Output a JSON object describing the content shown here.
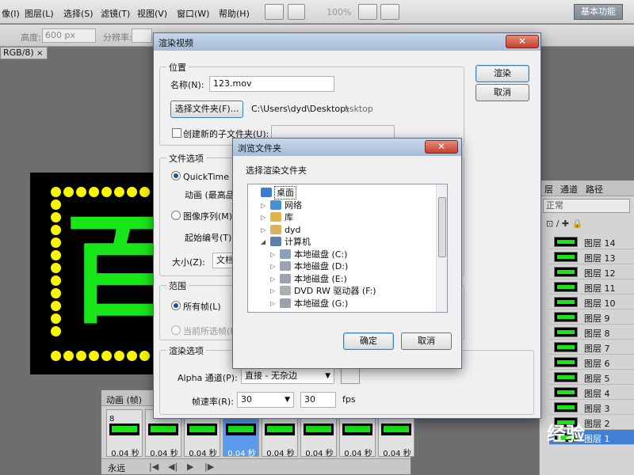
{
  "menu": {
    "items": [
      "像(I)",
      "图层(L)",
      "选择(S)",
      "滤镜(T)",
      "视图(V)",
      "窗口(W)",
      "帮助(H)"
    ],
    "zoom": "100%",
    "workspace": "基本功能"
  },
  "options_bar": {
    "height_label": "高度:",
    "height_value": "600 px",
    "resolution_label": "分辨率:"
  },
  "document": {
    "tab_label": "RGB/8)",
    "close_glyph": "×",
    "artwork_char": "百"
  },
  "render_dialog": {
    "title": "渲染视频",
    "close_glyph": "✕",
    "render_button": "渲染",
    "cancel_button": "取消",
    "location": {
      "group_title": "位置",
      "name_label": "名称(N):",
      "name_value": "123.mov",
      "choose_folder_button": "选择文件夹(F)...",
      "folder_path": "C:\\Users\\dyd\\Desktop\\",
      "folder_path_overflow": "esktop",
      "subfolder_label": "创建新的子文件夹(U):"
    },
    "file_options": {
      "group_title": "文件选项",
      "quicktime_label": "QuickTime 导",
      "animation_label": "动画 (最高品",
      "image_sequence_label": "图像序列(M):",
      "start_number_label": "起始编号(T):",
      "size_label": "大小(Z):",
      "size_value": "文档"
    },
    "range": {
      "group_title": "范围",
      "all_frames_label": "所有帧(L)",
      "current_frames_label": "当前所选帧(E"
    },
    "render_options": {
      "group_title": "渲染选项",
      "alpha_label": "Alpha 通道(P):",
      "alpha_value": "直接 - 无杂边",
      "fps_label": "帧速率(R):",
      "fps_select_value": "30",
      "fps_input_value": "30",
      "fps_unit": "fps"
    }
  },
  "browse_dialog": {
    "title": "浏览文件夹",
    "close_glyph": "✕",
    "prompt": "选择渲染文件夹",
    "tree": [
      {
        "label": "桌面",
        "icon": "desktop-icon",
        "level": 0,
        "expander": "",
        "selected": true
      },
      {
        "label": "网络",
        "icon": "network-icon",
        "level": 1,
        "expander": "▷"
      },
      {
        "label": "库",
        "icon": "library-icon",
        "level": 1,
        "expander": "▷"
      },
      {
        "label": "dyd",
        "icon": "user-folder-icon",
        "level": 1,
        "expander": "▷"
      },
      {
        "label": "计算机",
        "icon": "computer-icon",
        "level": 1,
        "expander": "◢"
      },
      {
        "label": "本地磁盘 (C:)",
        "icon": "system-drive-icon",
        "level": 2,
        "expander": "▷"
      },
      {
        "label": "本地磁盘 (D:)",
        "icon": "drive-icon",
        "level": 2,
        "expander": "▷"
      },
      {
        "label": "本地磁盘 (E:)",
        "icon": "drive-icon",
        "level": 2,
        "expander": "▷"
      },
      {
        "label": "DVD RW 驱动器 (F:)",
        "icon": "dvd-drive-icon",
        "level": 2,
        "expander": "▷"
      },
      {
        "label": "本地磁盘 (G:)",
        "icon": "drive-icon",
        "level": 2,
        "expander": "▷"
      }
    ],
    "ok_button": "确定",
    "cancel_button": "取消"
  },
  "layers_panel": {
    "tabs": [
      "层",
      "通道",
      "路径"
    ],
    "blend_mode": "正常",
    "layers": [
      "图层 14",
      "图层 13",
      "图层 12",
      "图层 11",
      "图层 10",
      "图层 9",
      "图层 8",
      "图层 7",
      "图层 6",
      "图层 5",
      "图层 4",
      "图层 3",
      "图层 2",
      "图层 1"
    ],
    "selected_layer": "图层 1"
  },
  "animation_panel": {
    "title": "动画 (帧)",
    "first_frame_number": "8",
    "frame_duration": "0.04 秒",
    "frame_count": 8,
    "selected_frame_index": 3,
    "loop": "永远"
  },
  "watermark": "经验"
}
